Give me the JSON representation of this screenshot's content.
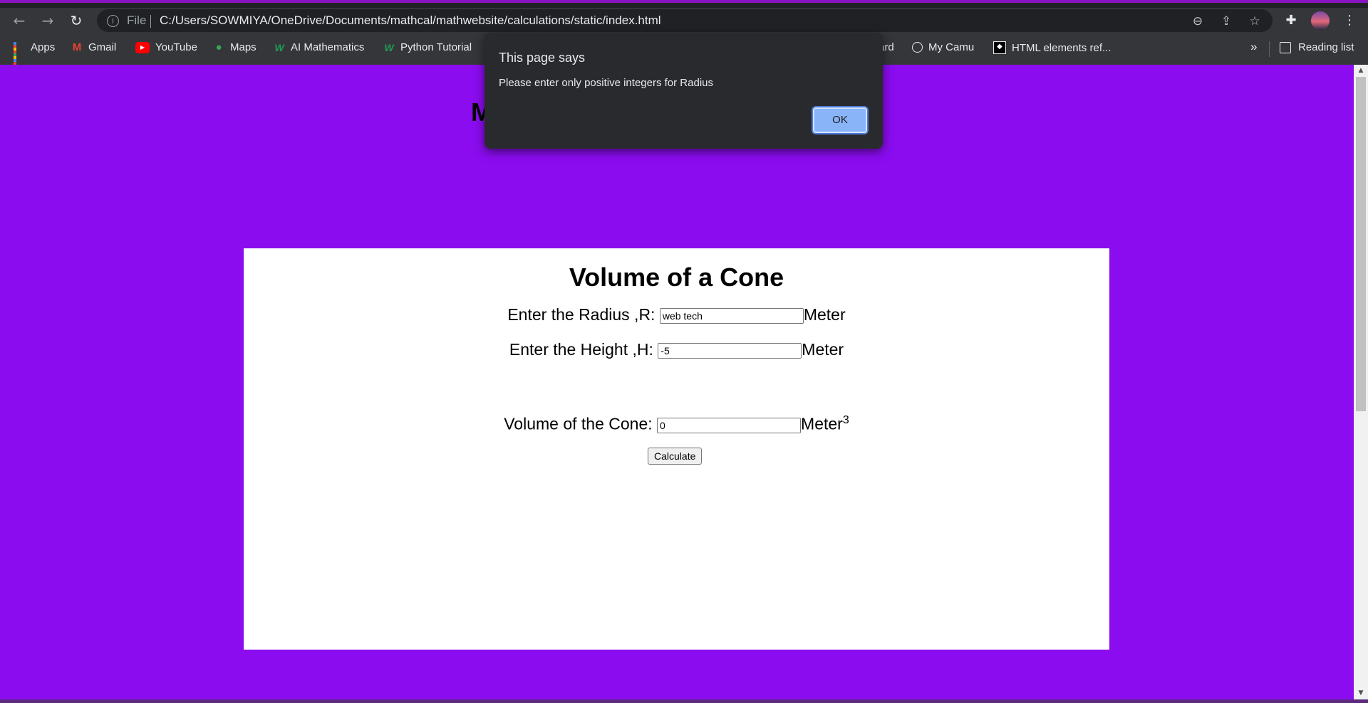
{
  "browser": {
    "address_scheme": "File",
    "address_url": "C:/Users/SOWMIYA/OneDrive/Documents/mathcal/mathwebsite/calculations/static/index.html",
    "icons": {
      "back": "back-arrow-icon",
      "forward": "forward-arrow-icon",
      "reload": "reload-icon",
      "info": "info-icon",
      "zoom": "zoom-out-icon",
      "share": "share-icon",
      "bookmark": "star-icon",
      "extensions": "puzzle-icon",
      "profile": "avatar",
      "menu": "kebab-menu-icon"
    }
  },
  "bookmarks": {
    "items": [
      {
        "label": "Apps",
        "icon": "apps-grid-icon"
      },
      {
        "label": "Gmail",
        "icon": "gmail-icon"
      },
      {
        "label": "YouTube",
        "icon": "youtube-icon"
      },
      {
        "label": "Maps",
        "icon": "maps-pin-icon"
      },
      {
        "label": "AI Mathematics",
        "icon": "w-site-icon"
      },
      {
        "label": "Python Tutorial",
        "icon": "w-site-icon"
      },
      {
        "label": "ard",
        "icon": ""
      },
      {
        "label": "My Camu",
        "icon": "globe-icon"
      },
      {
        "label": "HTML elements ref...",
        "icon": "mdn-icon"
      }
    ],
    "overflow": "»",
    "reading_list": "Reading list"
  },
  "page": {
    "partial_heading": "M",
    "card": {
      "title": "Volume of a Cone",
      "radius_label": "Enter the Radius ,R:",
      "radius_value": "web tech",
      "radius_unit": "Meter",
      "height_label": "Enter the Height ,H:",
      "height_value": "-5",
      "height_unit": "Meter",
      "calculate_label": "Calculate",
      "volume_label": "Volume of the Cone:",
      "volume_value": "0",
      "volume_unit": "Meter",
      "volume_unit_sup": "3"
    },
    "colors": {
      "background": "#8a0cef",
      "card": "#ffffff"
    }
  },
  "dialog": {
    "title": "This page says",
    "message": "Please enter only positive integers for Radius",
    "ok_label": "OK"
  }
}
